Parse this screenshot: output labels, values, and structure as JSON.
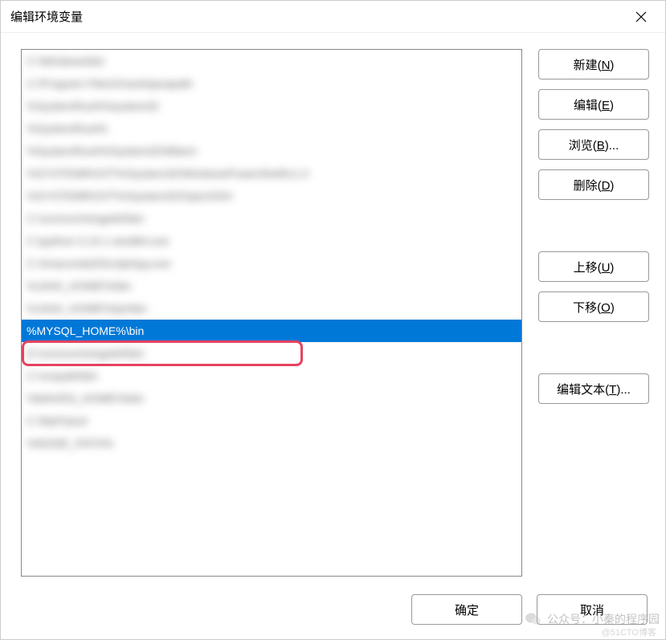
{
  "dialog": {
    "title": "编辑环境变量"
  },
  "list": {
    "items": [
      {
        "text": "C:\\Windows\\bin",
        "blurred": true,
        "selected": false
      },
      {
        "text": "C:\\Program Files\\Oracle\\javapath",
        "blurred": true,
        "selected": false
      },
      {
        "text": "%SystemRoot%\\system32",
        "blurred": true,
        "selected": false
      },
      {
        "text": "%SystemRoot%",
        "blurred": true,
        "selected": false
      },
      {
        "text": "%SystemRoot%\\System32\\Wbem",
        "blurred": true,
        "selected": false
      },
      {
        "text": "%SYSTEMROOT%\\System32\\WindowsPowerShell\\v1.0",
        "blurred": true,
        "selected": false
      },
      {
        "text": "%SYSTEMROOT%\\System32\\OpenSSH",
        "blurred": true,
        "selected": false
      },
      {
        "text": "C:\\xxx\\xxx\\mingw64\\bin",
        "blurred": true,
        "selected": false
      },
      {
        "text": "C:\\python-3.10.1-amd64.exe",
        "blurred": true,
        "selected": false
      },
      {
        "text": "C:\\Anaconda3\\Scripts\\py.exe",
        "blurred": true,
        "selected": false
      },
      {
        "text": "%JAVA_HOME%\\bin",
        "blurred": true,
        "selected": false
      },
      {
        "text": "%JAVA_HOME%\\jre\\bin",
        "blurred": true,
        "selected": false
      },
      {
        "text": "%MYSQL_HOME%\\bin",
        "blurred": false,
        "selected": true
      },
      {
        "text": "D:\\xxx\\xxx\\mingw64\\bin",
        "blurred": true,
        "selected": false
      },
      {
        "text": "C:\\xxxpath\\bin",
        "blurred": true,
        "selected": false
      },
      {
        "text": "%MAVEN_HOME%\\bin",
        "blurred": true,
        "selected": false
      },
      {
        "text": "C:\\MyPytool",
        "blurred": true,
        "selected": false
      },
      {
        "text": "%NODE_PATH%",
        "blurred": true,
        "selected": false
      }
    ]
  },
  "buttons": {
    "new": "新建(N)",
    "edit": "编辑(E)",
    "browse": "浏览(B)...",
    "delete": "删除(D)",
    "moveUp": "上移(U)",
    "moveDown": "下移(O)",
    "editText": "编辑文本(T)...",
    "ok": "确定",
    "cancel": "取消"
  },
  "watermark": {
    "text": "公众号：小秦的程序园",
    "sub": "@51CTO博客"
  }
}
